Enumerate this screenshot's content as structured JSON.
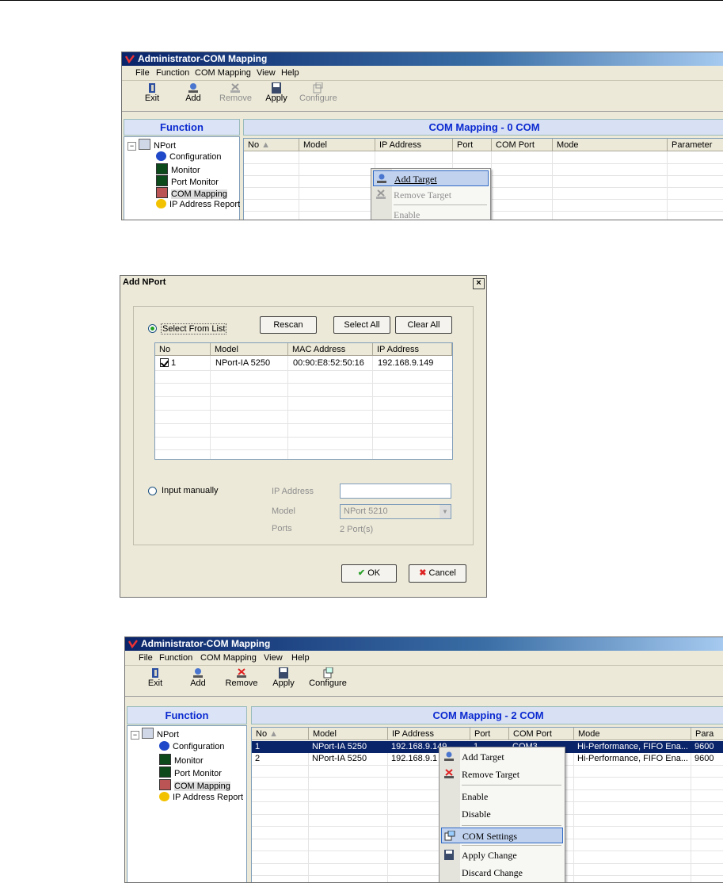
{
  "screen1": {
    "title": "Administrator-COM Mapping",
    "menu": [
      {
        "label": "File"
      },
      {
        "label": "Function"
      },
      {
        "label": "COM Mapping"
      },
      {
        "label": "View"
      },
      {
        "label": "Help"
      }
    ],
    "toolbar": {
      "exit": "Exit",
      "add": "Add",
      "remove": "Remove",
      "apply": "Apply",
      "configure": "Configure"
    },
    "function_header": "Function",
    "mapping_header": "COM Mapping - 0 COM",
    "tree": {
      "root": "NPort",
      "items": [
        "Configuration",
        "Monitor",
        "Port Monitor",
        "COM Mapping",
        "IP Address Report"
      ]
    },
    "columns": [
      "No",
      "Model",
      "IP Address",
      "Port",
      "COM Port",
      "Mode",
      "Parameter"
    ],
    "context_menu": {
      "add_target": "Add Target",
      "remove_target": "Remove Target",
      "enable": "Enable"
    }
  },
  "dialog": {
    "title": "Add NPort",
    "close": "×",
    "select_from_list": "Select From List",
    "rescan": "Rescan",
    "select_all": "Select All",
    "clear_all": "Clear All",
    "columns": [
      "No",
      "Model",
      "MAC Address",
      "IP Address"
    ],
    "rows": [
      {
        "no": "1",
        "model": "NPort-IA 5250",
        "mac": "00:90:E8:52:50:16",
        "ip": "192.168.9.149",
        "checked": true
      }
    ],
    "input_manually": "Input manually",
    "ip_label": "IP Address",
    "ip_value": "",
    "model_label": "Model",
    "model_value": "NPort 5210",
    "ports_label": "Ports",
    "ports_value": "2 Port(s)",
    "ok": "OK",
    "cancel": "Cancel"
  },
  "screen2": {
    "title": "Administrator-COM Mapping",
    "menu": [
      {
        "label": "File"
      },
      {
        "label": "Function"
      },
      {
        "label": "COM Mapping"
      },
      {
        "label": "View"
      },
      {
        "label": "Help"
      }
    ],
    "toolbar": {
      "exit": "Exit",
      "add": "Add",
      "remove": "Remove",
      "apply": "Apply",
      "configure": "Configure"
    },
    "function_header": "Function",
    "mapping_header": "COM Mapping - 2 COM",
    "tree": {
      "root": "NPort",
      "items": [
        "Configuration",
        "Monitor",
        "Port Monitor",
        "COM Mapping",
        "IP Address Report"
      ]
    },
    "columns": [
      "No",
      "Model",
      "IP Address",
      "Port",
      "COM Port",
      "Mode",
      "Para"
    ],
    "rows": [
      {
        "no": "1",
        "model": "NPort-IA 5250",
        "ip": "192.168.9.149",
        "port": "1",
        "com": "COM3",
        "mode": "Hi-Performance, FIFO Ena...",
        "param": "9600"
      },
      {
        "no": "2",
        "model": "NPort-IA 5250",
        "ip": "192.168.9.1",
        "port": "",
        "com": "",
        "mode": "Hi-Performance, FIFO Ena...",
        "param": "9600"
      }
    ],
    "context_menu": {
      "add_target": "Add Target",
      "remove_target": "Remove Target",
      "enable": "Enable",
      "disable": "Disable",
      "com_settings": "COM Settings",
      "apply_change": "Apply Change",
      "discard_change": "Discard Change"
    }
  },
  "colors": {
    "title_bar": "#0a246a",
    "header_text": "#0b2ad0",
    "selection": "#0a246a",
    "chrome": "#ece9d8"
  }
}
